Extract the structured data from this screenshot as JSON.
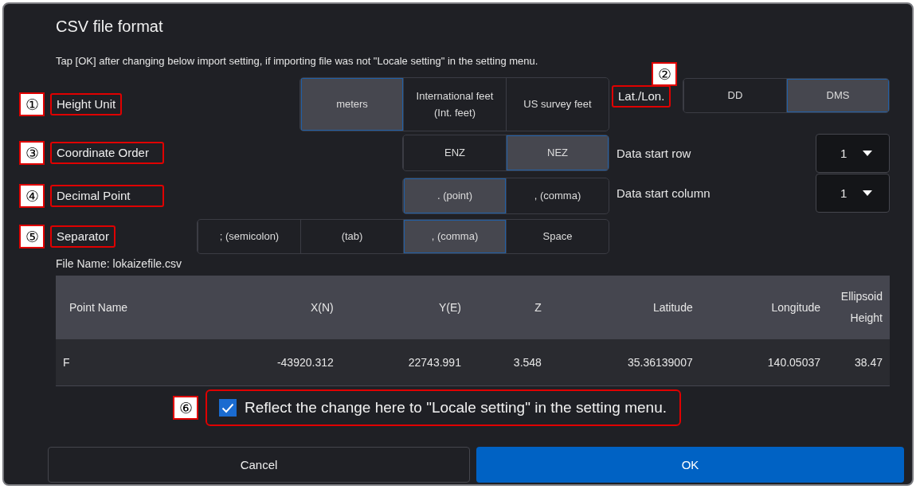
{
  "dialog": {
    "title": "CSV file format",
    "instruction": "Tap [OK] after changing below import setting, if importing file was not \"Locale setting\" in the setting menu."
  },
  "settings": [
    {
      "callout": "①",
      "label": "Height Unit",
      "options": [
        {
          "label": "meters",
          "selected": true
        },
        {
          "label": "International feet (Int. feet)",
          "selected": false
        },
        {
          "label": "US survey feet",
          "selected": false
        }
      ]
    },
    {
      "callout": "③",
      "label": "Coordinate Order",
      "options": [
        {
          "label": "ENZ",
          "selected": false
        },
        {
          "label": "NEZ",
          "selected": true
        }
      ]
    },
    {
      "callout": "④",
      "label": "Decimal Point",
      "options": [
        {
          "label": ". (point)",
          "selected": true
        },
        {
          "label": ", (comma)",
          "selected": false
        }
      ]
    },
    {
      "callout": "⑤",
      "label": "Separator",
      "options": [
        {
          "label": "; (semicolon)",
          "selected": false
        },
        {
          "label": "(tab)",
          "selected": false
        },
        {
          "label": ", (comma)",
          "selected": true
        },
        {
          "label": "Space",
          "selected": false
        }
      ]
    }
  ],
  "lat_lon": {
    "callout": "②",
    "label": "Lat./Lon.",
    "options": [
      {
        "label": "DD",
        "selected": false
      },
      {
        "label": "DMS",
        "selected": true
      }
    ]
  },
  "start_settings": [
    {
      "label": "Data start row",
      "value": "1"
    },
    {
      "label": "Data start column",
      "value": "1"
    }
  ],
  "file_name": "File Name: lokaizefile.csv",
  "table": {
    "columns": [
      "Point Name",
      "X(N)",
      "Y(E)",
      "Z",
      "Latitude",
      "Longitude",
      "Ellipsoid Height"
    ],
    "rows": [
      [
        "F",
        "-43920.312",
        "22743.991",
        "3.548",
        "35.36139007",
        "140.05037",
        "38.47"
      ]
    ]
  },
  "reflect": {
    "callout": "⑥",
    "label": "Reflect the change here to \"Locale setting\" in the setting menu.",
    "checked": true
  },
  "buttons": [
    {
      "label": "Cancel",
      "kind": "secondary"
    },
    {
      "label": "OK",
      "kind": "primary"
    }
  ]
}
